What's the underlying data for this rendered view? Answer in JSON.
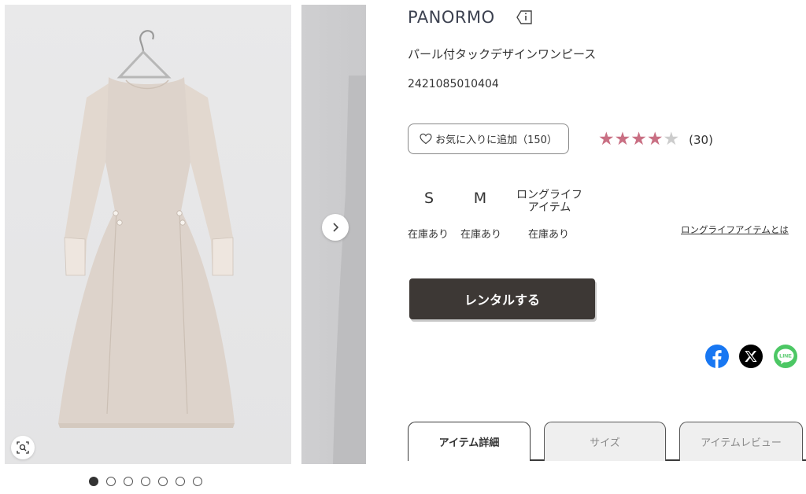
{
  "brand": {
    "name": "PANORMO"
  },
  "product": {
    "name": "パール付タックデザインワンピース",
    "code": "2421085010404"
  },
  "favorite": {
    "label": "お気に入りに追加（150）"
  },
  "rating": {
    "stars": 4,
    "max": 5,
    "count_label": "(30)",
    "star_color": "#c96f83",
    "empty_color": "#cccccc"
  },
  "sizes": [
    {
      "label": "S",
      "stock": "在庫あり"
    },
    {
      "label": "M",
      "stock": "在庫あり"
    },
    {
      "label_line1": "ロングライフ",
      "label_line2": "アイテム",
      "stock": "在庫あり"
    }
  ],
  "longlife_link": "ロングライフアイテムとは",
  "rent_button": "レンタルする",
  "share": [
    {
      "icon": "facebook-icon",
      "color": "#1877f2"
    },
    {
      "icon": "x-icon",
      "color": "#000000"
    },
    {
      "icon": "line-icon",
      "color": "#4cc764",
      "text": "LINE"
    }
  ],
  "tabs": [
    {
      "label": "アイテム詳細",
      "active": true
    },
    {
      "label": "サイズ",
      "active": false
    },
    {
      "label": "アイテムレビュー",
      "active": false
    }
  ],
  "gallery": {
    "total_images": 7,
    "current_index": 0
  },
  "colors": {
    "button_dark": "#3d3835",
    "dress": "#ddd3cb"
  }
}
